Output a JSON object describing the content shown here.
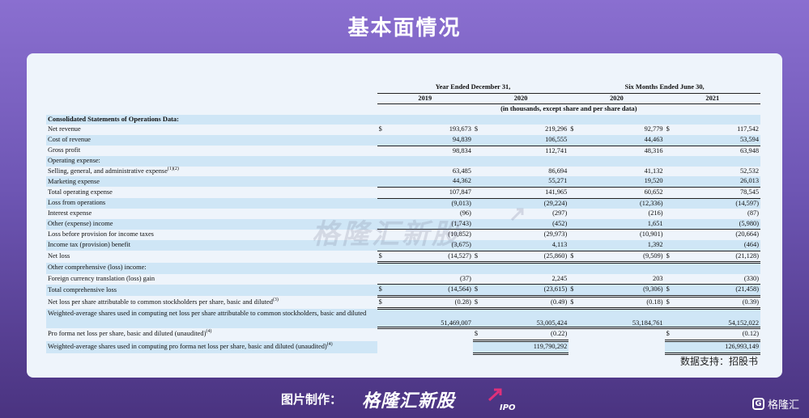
{
  "page_title": "基本面情况",
  "table": {
    "header_group_1": "Year Ended December 31,",
    "header_group_2": "Six Months Ended June 30,",
    "years": [
      "2019",
      "2020",
      "2020",
      "2021"
    ],
    "units_note": "(in thousands, except share and per share data)",
    "rows": [
      {
        "label": "Consolidated Statements of Operations Data:",
        "kind": "section",
        "shade": true
      },
      {
        "label": "Net revenue",
        "v": [
          "193,673",
          "219,296",
          "92,779",
          "117,542"
        ],
        "cur": [
          "$",
          "$",
          "$",
          "$"
        ],
        "shade": false
      },
      {
        "label": "Cost of revenue",
        "v": [
          "94,839",
          "106,555",
          "44,463",
          "53,594"
        ],
        "shade": true,
        "underline": true
      },
      {
        "label": "Gross profit",
        "v": [
          "98,834",
          "112,741",
          "48,316",
          "63,948"
        ],
        "shade": false
      },
      {
        "label": "Operating expense:",
        "kind": "plain",
        "shade": true
      },
      {
        "label": "Selling, general, and administrative expense",
        "sup": "(1)(2)",
        "v": [
          "63,485",
          "86,694",
          "41,132",
          "52,532"
        ],
        "shade": false
      },
      {
        "label": "Marketing expense",
        "v": [
          "44,362",
          "55,271",
          "19,520",
          "26,013"
        ],
        "shade": true,
        "underline": true
      },
      {
        "label": "Total operating expense",
        "v": [
          "107,847",
          "141,965",
          "60,652",
          "78,545"
        ],
        "shade": false,
        "underline": true
      },
      {
        "label": "Loss from operations",
        "v": [
          "(9,013)",
          "(29,224)",
          "(12,336)",
          "(14,597)"
        ],
        "shade": true
      },
      {
        "label": "Interest expense",
        "v": [
          "(96)",
          "(297)",
          "(216)",
          "(87)"
        ],
        "shade": false
      },
      {
        "label": "Other (expense) income",
        "v": [
          "(1,743)",
          "(452)",
          "1,651",
          "(5,980)"
        ],
        "shade": true,
        "underline": true
      },
      {
        "label": "Loss before provision for income taxes",
        "v": [
          "(10,852)",
          "(29,973)",
          "(10,901)",
          "(20,664)"
        ],
        "shade": false
      },
      {
        "label": "Income tax (provision) benefit",
        "v": [
          "(3,675)",
          "4,113",
          "1,392",
          "(464)"
        ],
        "shade": true,
        "underline": true
      },
      {
        "label": "Net loss",
        "v": [
          "(14,527)",
          "(25,860)",
          "(9,509)",
          "(21,128)"
        ],
        "cur": [
          "$",
          "$",
          "$",
          "$"
        ],
        "shade": false,
        "double": true
      },
      {
        "label": "Other comprehensive (loss) income:",
        "kind": "plain",
        "shade": true
      },
      {
        "label": "Foreign currency translation (loss) gain",
        "v": [
          "(37)",
          "2,245",
          "203",
          "(330)"
        ],
        "shade": false,
        "underline": true
      },
      {
        "label": "Total comprehensive loss",
        "v": [
          "(14,564)",
          "(23,615)",
          "(9,306)",
          "(21,458)"
        ],
        "cur": [
          "$",
          "$",
          "$",
          "$"
        ],
        "shade": true,
        "double": true
      },
      {
        "label": "Net loss per share attributable to common stockholders per share, basic and diluted",
        "sup": "(3)",
        "v": [
          "(0.28)",
          "(0.49)",
          "(0.18)",
          "(0.39)"
        ],
        "cur": [
          "$",
          "$",
          "$",
          "$"
        ],
        "shade": false,
        "double": true
      },
      {
        "label": "Weighted-average shares used in computing net loss per share attributable to common stockholders, basic and diluted",
        "v": [
          "51,469,007",
          "53,005,424",
          "53,184,761",
          "54,152,022"
        ],
        "shade": true,
        "double": true,
        "tall": true
      },
      {
        "label": "Pro forma net loss per share, basic and diluted (unaudited)",
        "sup": "(4)",
        "v": [
          "",
          "(0.22)",
          "",
          "(0.12)"
        ],
        "cur": [
          "",
          "$",
          "",
          "$"
        ],
        "shade": false,
        "double": true
      },
      {
        "label": "Weighted-average shares used in computing pro forma net loss per share, basic and diluted (unaudited)",
        "sup": "(4)",
        "v": [
          "",
          "119,790,292",
          "",
          "126,993,149"
        ],
        "shade": true,
        "double": true
      }
    ]
  },
  "watermark": "格隆汇新股",
  "source": "数据支持：招股书",
  "footer": {
    "made_by": "图片制作：",
    "brand": "格隆汇新股",
    "brand_sub": "IPO",
    "corner": "格隆汇"
  }
}
